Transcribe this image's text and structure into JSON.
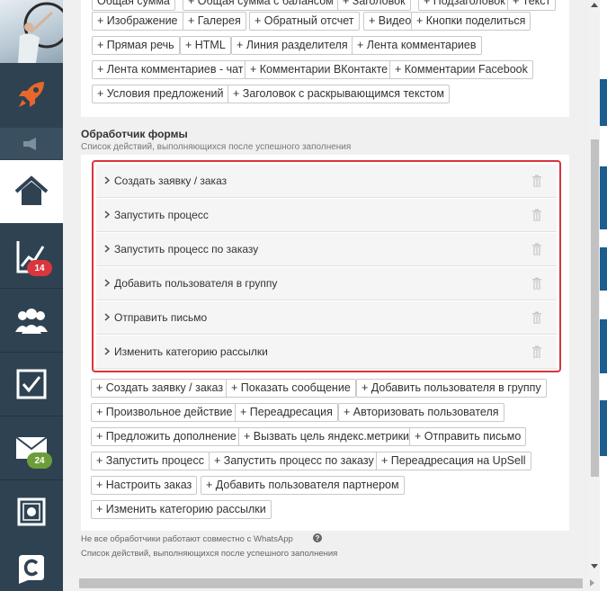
{
  "sidebar": {
    "badges": {
      "stats": "14",
      "mail": "24"
    },
    "icons": [
      "rocket-icon",
      "megaphone-icon",
      "home-icon",
      "chart-icon",
      "users-icon",
      "checkbox-icon",
      "mail-icon",
      "safe-icon",
      "logo-c-icon"
    ]
  },
  "blocks": {
    "row0": [
      "Общая сумма",
      "+ Общая сумма с балансом",
      "+ Заголовок",
      "+ Подзаголовок",
      "+ Текст"
    ],
    "row1": [
      "+ Изображение",
      "+ Галерея",
      "+ Обратный отсчет",
      "+ Видео",
      "+ Кнопки поделиться"
    ],
    "row2": [
      "+ Прямая речь",
      "+ HTML",
      "+ Линия разделителя",
      "+ Лента комментариев"
    ],
    "row3": [
      "+ Лента комментариев - чат",
      "+ Комментарии ВКонтакте",
      "+ Комментарии Facebook"
    ],
    "row4": [
      "+ Условия предложений",
      "+ Заголовок с раскрывающимся текстом"
    ]
  },
  "form_handler": {
    "title": "Обработчик формы",
    "subtitle": "Список действий, выполняющихся после успешного заполнения",
    "actions": [
      "Создать заявку / заказ",
      "Запустить процесс",
      "Запустить процесс по заказу",
      "Добавить пользователя в группу",
      "Отправить письмо",
      "Изменить категорию рассылки"
    ],
    "add_row0": [
      "+ Создать заявку / заказ",
      "+ Показать сообщение",
      "+ Добавить пользователя в группу"
    ],
    "add_row1": [
      "+ Произвольное действие",
      "+ Переадресация",
      "+ Авторизовать пользователя"
    ],
    "add_row2": [
      "+ Предложить дополнение",
      "+ Вызвать цель яндекс.метрики",
      "+ Отправить письмо"
    ],
    "add_row3": [
      "+ Запустить процесс",
      "+ Запустить процесс по заказу",
      "+ Переадресация на UpSell"
    ],
    "add_row4": [
      "+ Настроить заказ",
      "+ Добавить пользователя партнером"
    ],
    "add_row5": [
      "+ Изменить категорию рассылки"
    ],
    "note_whatsapp": "Не все обработчики работают совместно с WhatsApp",
    "note_sub": "Список действий, выполняющихся после успешного заполнения",
    "help_glyph": "?"
  },
  "colors": {
    "sidebar": "#2e4252",
    "highlight": "#d9353a",
    "badge_red": "#d9363e",
    "badge_green": "#6b9e3a",
    "accent_orange": "#e8672a"
  }
}
